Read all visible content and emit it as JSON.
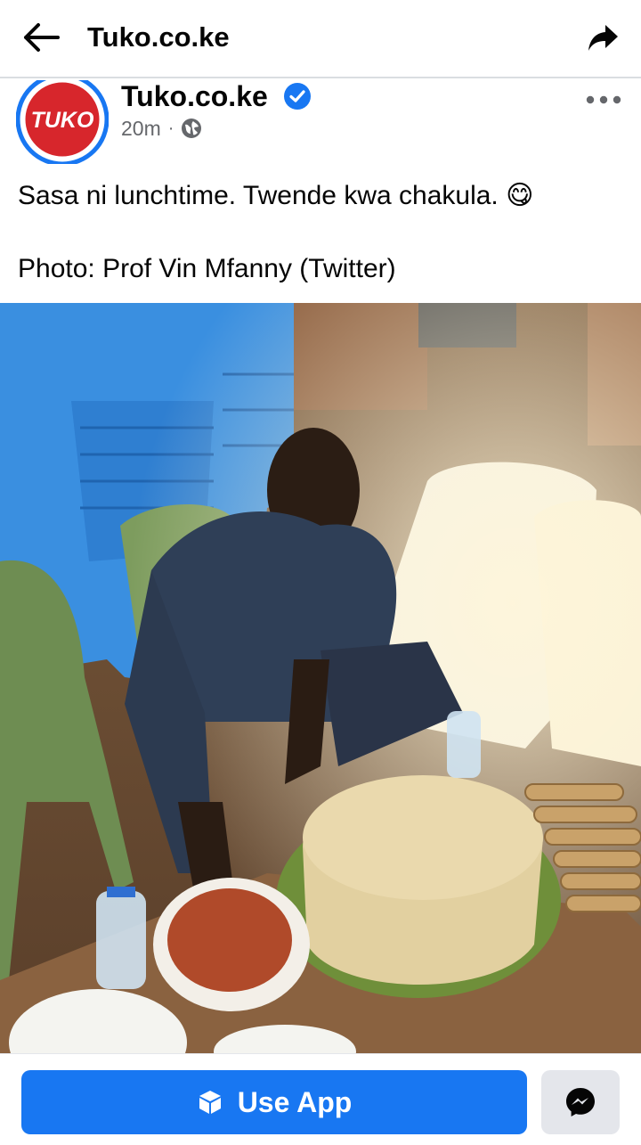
{
  "topbar": {
    "back_icon": "arrow-left-icon",
    "title": "Tuko.co.ke",
    "share_icon": "share-arrow-icon"
  },
  "post": {
    "author": "Tuko.co.ke",
    "avatar_text": "TUKO",
    "verified_icon": "verified-badge-icon",
    "time": "20m",
    "separator": "·",
    "audience_icon": "globe-icon",
    "more_icon": "more-dots-icon",
    "text_line1": "Sasa ni lunchtime. Twende kwa chakula.",
    "emoji": "😋",
    "text_line2": "Photo: Prof Vin Mfanny (Twitter)"
  },
  "bottombar": {
    "use_app_label": "Use App",
    "use_app_icon": "cube-icon",
    "messenger_icon": "messenger-icon"
  },
  "colors": {
    "brand_blue": "#1877f2",
    "tuko_red": "#d7262c",
    "muted_text": "#65676b"
  }
}
